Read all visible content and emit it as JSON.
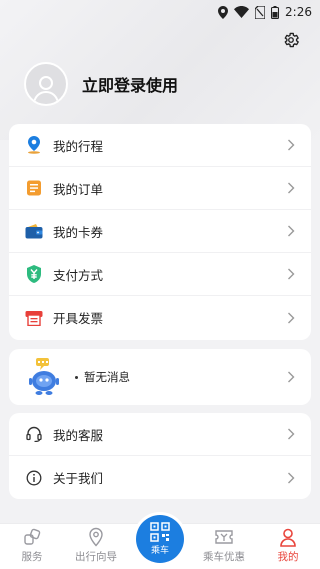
{
  "status": {
    "time": "2:26"
  },
  "profile": {
    "login_label": "立即登录使用"
  },
  "menu": {
    "items": [
      {
        "label": "我的行程",
        "icon": "location-pin-icon"
      },
      {
        "label": "我的订单",
        "icon": "order-list-icon"
      },
      {
        "label": "我的卡券",
        "icon": "wallet-icon"
      },
      {
        "label": "支付方式",
        "icon": "yuan-shield-icon"
      },
      {
        "label": "开具发票",
        "icon": "invoice-printer-icon"
      }
    ]
  },
  "messages": {
    "text": "暂无消息"
  },
  "service": {
    "items": [
      {
        "label": "我的客服",
        "icon": "headset-icon"
      },
      {
        "label": "关于我们",
        "icon": "info-icon"
      }
    ]
  },
  "tabbar": {
    "tabs": [
      {
        "label": "服务",
        "icon": "service-icon"
      },
      {
        "label": "出行向导",
        "icon": "map-marker-icon"
      },
      {
        "label": "乘车",
        "icon": "qr-code-icon"
      },
      {
        "label": "乘车优惠",
        "icon": "ticket-icon"
      },
      {
        "label": "我的",
        "icon": "person-icon"
      }
    ],
    "active": "我的"
  },
  "colors": {
    "accent": "#1c7ee0",
    "active_tab": "#e9453c"
  }
}
